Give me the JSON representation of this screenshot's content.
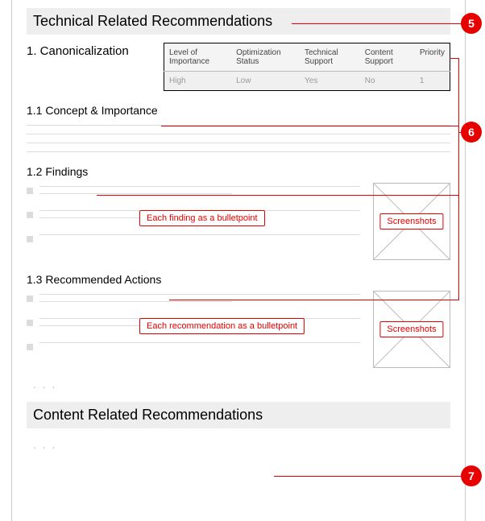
{
  "badges": {
    "b5": "5",
    "b6": "6",
    "b7": "7"
  },
  "sections": {
    "technical": {
      "header": "Technical Related Recommendations",
      "item1": {
        "title": "1. Canonicalization",
        "table": {
          "h1": "Level of Importance",
          "h2": "Optimization Status",
          "h3": "Technical Support",
          "h4": "Content Support",
          "h5": "Priority",
          "v1": "High",
          "v2": "Low",
          "v3": "Yes",
          "v4": "No",
          "v5": "1"
        },
        "sub1": {
          "title": "1.1 Concept & Importance"
        },
        "sub2": {
          "title": "1.2 Findings",
          "pill": "Each finding as a bulletpoint",
          "thumb": "Screenshots"
        },
        "sub3": {
          "title": "1.3 Recommended Actions",
          "pill": "Each recommendation as a bulletpoint",
          "thumb": "Screenshots"
        }
      }
    },
    "content": {
      "header": "Content Related Recommendations"
    },
    "ellipsis": ". . ."
  }
}
